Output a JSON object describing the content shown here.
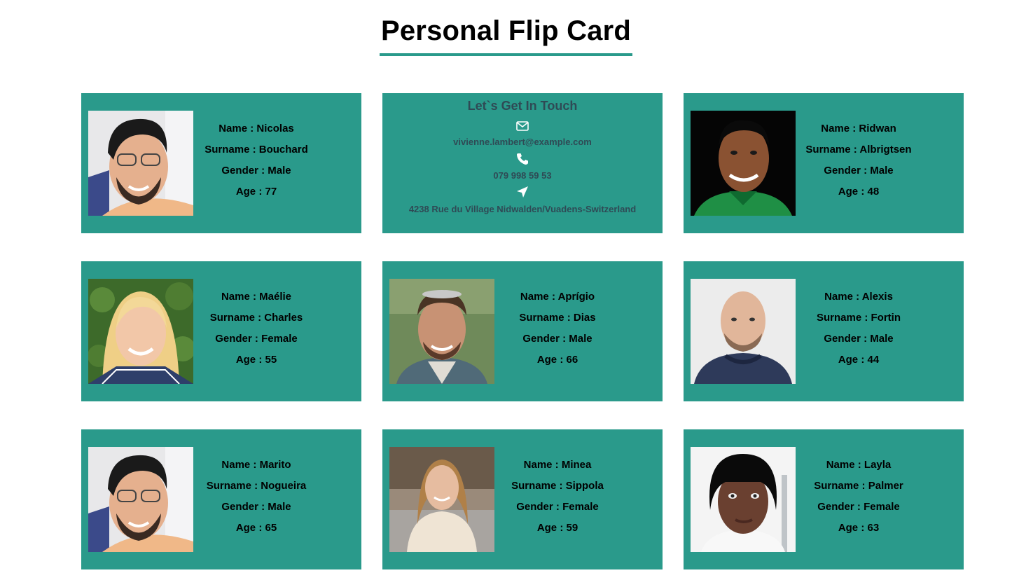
{
  "page": {
    "title": "Personal Flip Card"
  },
  "labels": {
    "name": "Name : ",
    "surname": "Surname : ",
    "gender": "Gender : ",
    "age": "Age : "
  },
  "contact": {
    "title": "Let`s Get In Touch",
    "email": "vivienne.lambert@example.com",
    "phone": "079 998 59 53",
    "address": "4238 Rue du Village Nidwalden/Vuadens-Switzerland",
    "icons": [
      "envelope-icon",
      "phone-icon",
      "location-arrow-icon"
    ]
  },
  "cards": [
    {
      "name": "Nicolas",
      "surname": "Bouchard",
      "gender": "Male",
      "age": "77",
      "photo": "man-glasses-dark-hair"
    },
    {
      "name": "Ridwan",
      "surname": "Albrigtsen",
      "gender": "Male",
      "age": "48",
      "photo": "man-green-shirt"
    },
    {
      "name": "Maélie",
      "surname": "Charles",
      "gender": "Female",
      "age": "55",
      "photo": "woman-blonde"
    },
    {
      "name": "Aprígio",
      "surname": "Dias",
      "gender": "Male",
      "age": "66",
      "photo": "man-plaid-shirt"
    },
    {
      "name": "Alexis",
      "surname": "Fortin",
      "gender": "Male",
      "age": "44",
      "photo": "man-bald-beard"
    },
    {
      "name": "Marito",
      "surname": "Nogueira",
      "gender": "Male",
      "age": "65",
      "photo": "man-glasses-dark-hair"
    },
    {
      "name": "Minea",
      "surname": "Sippola",
      "gender": "Female",
      "age": "59",
      "photo": "woman-street"
    },
    {
      "name": "Layla",
      "surname": "Palmer",
      "gender": "Female",
      "age": "63",
      "photo": "woman-bob-hair"
    }
  ],
  "colors": {
    "card_bg": "#2a9a8b",
    "title_underline": "#2a9a8b",
    "contact_text": "#2f4a55"
  }
}
